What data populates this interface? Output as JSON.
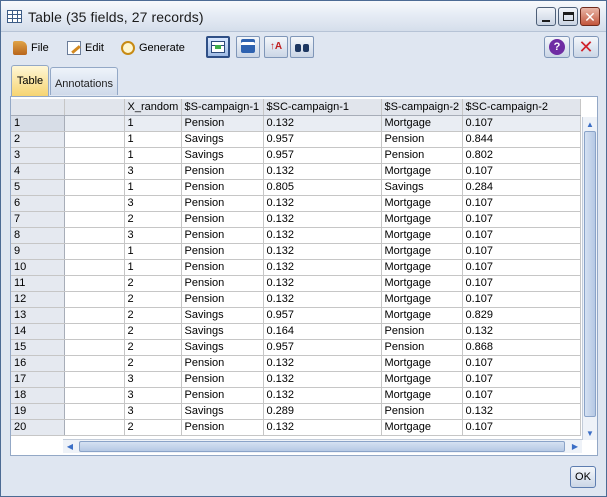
{
  "window": {
    "title": "Table (35 fields, 27 records)"
  },
  "toolbar": {
    "file_label": "File",
    "edit_label": "Edit",
    "generate_label": "Generate",
    "icons": [
      "table-view-icon",
      "print-icon",
      "sort-icon",
      "find-icon"
    ]
  },
  "tabs": [
    {
      "label": "Table",
      "selected": true
    },
    {
      "label": "Annotations",
      "selected": false
    }
  ],
  "table": {
    "columns": [
      "",
      "",
      "X_random",
      "$S-campaign-1",
      "$SC-campaign-1",
      "$S-campaign-2",
      "$SC-campaign-2"
    ],
    "rows": [
      {
        "num": "1",
        "x": "1",
        "s1": "Pension",
        "sc1": "0.132",
        "s2": "Mortgage",
        "sc2": "0.107"
      },
      {
        "num": "2",
        "x": "1",
        "s1": "Savings",
        "sc1": "0.957",
        "s2": "Pension",
        "sc2": "0.844"
      },
      {
        "num": "3",
        "x": "1",
        "s1": "Savings",
        "sc1": "0.957",
        "s2": "Pension",
        "sc2": "0.802"
      },
      {
        "num": "4",
        "x": "3",
        "s1": "Pension",
        "sc1": "0.132",
        "s2": "Mortgage",
        "sc2": "0.107"
      },
      {
        "num": "5",
        "x": "1",
        "s1": "Pension",
        "sc1": "0.805",
        "s2": "Savings",
        "sc2": "0.284"
      },
      {
        "num": "6",
        "x": "3",
        "s1": "Pension",
        "sc1": "0.132",
        "s2": "Mortgage",
        "sc2": "0.107"
      },
      {
        "num": "7",
        "x": "2",
        "s1": "Pension",
        "sc1": "0.132",
        "s2": "Mortgage",
        "sc2": "0.107"
      },
      {
        "num": "8",
        "x": "3",
        "s1": "Pension",
        "sc1": "0.132",
        "s2": "Mortgage",
        "sc2": "0.107"
      },
      {
        "num": "9",
        "x": "1",
        "s1": "Pension",
        "sc1": "0.132",
        "s2": "Mortgage",
        "sc2": "0.107"
      },
      {
        "num": "10",
        "x": "1",
        "s1": "Pension",
        "sc1": "0.132",
        "s2": "Mortgage",
        "sc2": "0.107"
      },
      {
        "num": "11",
        "x": "2",
        "s1": "Pension",
        "sc1": "0.132",
        "s2": "Mortgage",
        "sc2": "0.107"
      },
      {
        "num": "12",
        "x": "2",
        "s1": "Pension",
        "sc1": "0.132",
        "s2": "Mortgage",
        "sc2": "0.107"
      },
      {
        "num": "13",
        "x": "2",
        "s1": "Savings",
        "sc1": "0.957",
        "s2": "Mortgage",
        "sc2": "0.829"
      },
      {
        "num": "14",
        "x": "2",
        "s1": "Savings",
        "sc1": "0.164",
        "s2": "Pension",
        "sc2": "0.132"
      },
      {
        "num": "15",
        "x": "2",
        "s1": "Savings",
        "sc1": "0.957",
        "s2": "Pension",
        "sc2": "0.868"
      },
      {
        "num": "16",
        "x": "2",
        "s1": "Pension",
        "sc1": "0.132",
        "s2": "Mortgage",
        "sc2": "0.107"
      },
      {
        "num": "17",
        "x": "3",
        "s1": "Pension",
        "sc1": "0.132",
        "s2": "Mortgage",
        "sc2": "0.107"
      },
      {
        "num": "18",
        "x": "3",
        "s1": "Pension",
        "sc1": "0.132",
        "s2": "Mortgage",
        "sc2": "0.107"
      },
      {
        "num": "19",
        "x": "3",
        "s1": "Savings",
        "sc1": "0.289",
        "s2": "Pension",
        "sc2": "0.132"
      },
      {
        "num": "20",
        "x": "2",
        "s1": "Pension",
        "sc1": "0.132",
        "s2": "Mortgage",
        "sc2": "0.107"
      }
    ]
  },
  "footer": {
    "ok_label": "OK"
  }
}
